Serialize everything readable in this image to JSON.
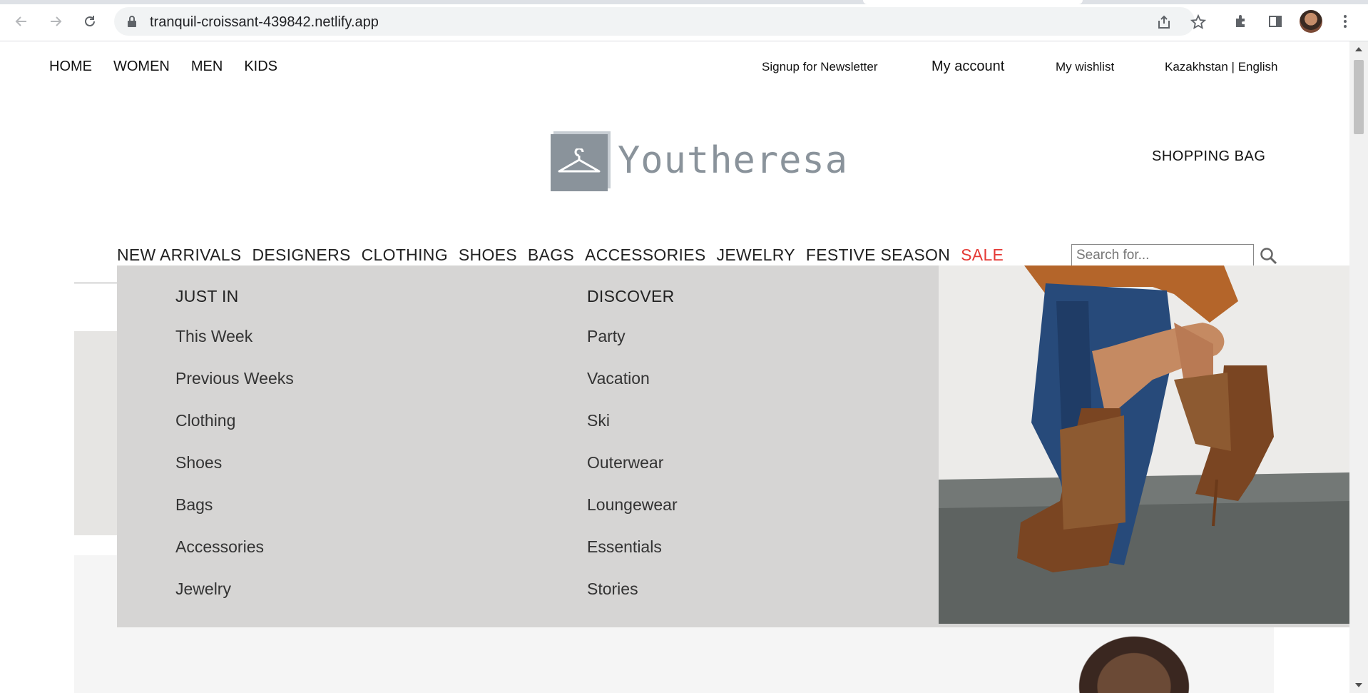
{
  "browser": {
    "url": "tranquil-croissant-439842.netlify.app",
    "back_icon": "arrow-left-icon",
    "forward_icon": "arrow-right-icon",
    "reload_icon": "reload-icon"
  },
  "header": {
    "top_nav": [
      "HOME",
      "WOMEN",
      "MEN",
      "KIDS"
    ],
    "newsletter": "Signup for Newsletter",
    "account": "My account",
    "wishlist": "My wishlist",
    "locale": "Kazakhstan | English",
    "logo_text": "Youtheresa",
    "shopping_bag": "SHOPPING BAG"
  },
  "category_nav": {
    "items": [
      "NEW ARRIVALS",
      "DESIGNERS",
      "CLOTHING",
      "SHOES",
      "BAGS",
      "ACCESSORIES",
      "JEWELRY",
      "FESTIVE SEASON"
    ],
    "sale": "SALE",
    "sale_color": "#e53935"
  },
  "search": {
    "placeholder": "Search for..."
  },
  "mega_menu": {
    "col1": {
      "heading": "JUST IN",
      "items": [
        "This Week",
        "Previous Weeks",
        "Clothing",
        "Shoes",
        "Bags",
        "Accessories",
        "Jewelry"
      ]
    },
    "col2": {
      "heading": "DISCOVER",
      "items": [
        "Party",
        "Vacation",
        "Ski",
        "Outerwear",
        "Loungewear",
        "Essentials",
        "Stories"
      ]
    }
  }
}
